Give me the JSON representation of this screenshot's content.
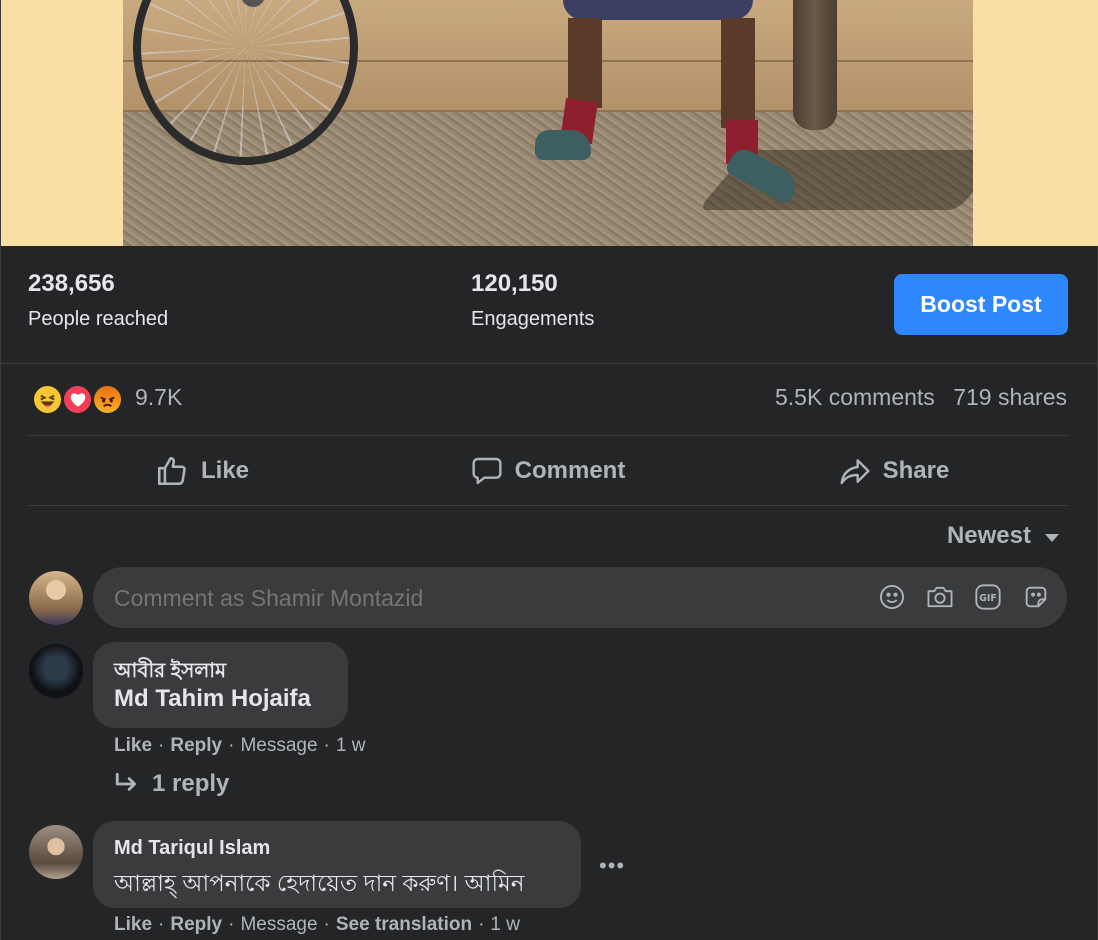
{
  "stats": {
    "reach_value": "238,656",
    "reach_label": "People reached",
    "engagement_value": "120,150",
    "engagement_label": "Engagements",
    "boost_label": "Boost Post"
  },
  "reactions": {
    "icons": [
      "haha",
      "love",
      "angry"
    ],
    "count": "9.7K",
    "comments": "5.5K comments",
    "shares": "719 shares"
  },
  "actions": {
    "like": "Like",
    "comment": "Comment",
    "share": "Share"
  },
  "sort": {
    "label": "Newest"
  },
  "composer": {
    "placeholder": "Comment as Shamir Montazid",
    "icons": [
      "emoji-icon",
      "camera-icon",
      "gif-icon",
      "sticker-icon"
    ]
  },
  "comments": [
    {
      "author": "আবীর ইসলাম",
      "text": "Md Tahim Hojaifa",
      "like": "Like",
      "reply": "Reply",
      "message": "Message",
      "time": "1 w",
      "replies": "1 reply"
    },
    {
      "author": "Md Tariqul Islam",
      "text": "আল্লাহ্ আপনাকে হেদায়েত দান করুণ। আমিন",
      "like": "Like",
      "reply": "Reply",
      "message": "Message",
      "see_translation": "See translation",
      "time": "1 w"
    }
  ],
  "colors": {
    "background": "#242526",
    "bubble": "#3a3b3c",
    "accent": "#2d88ff",
    "text_primary": "#e4e6eb",
    "text_secondary": "#b0b3b8"
  }
}
